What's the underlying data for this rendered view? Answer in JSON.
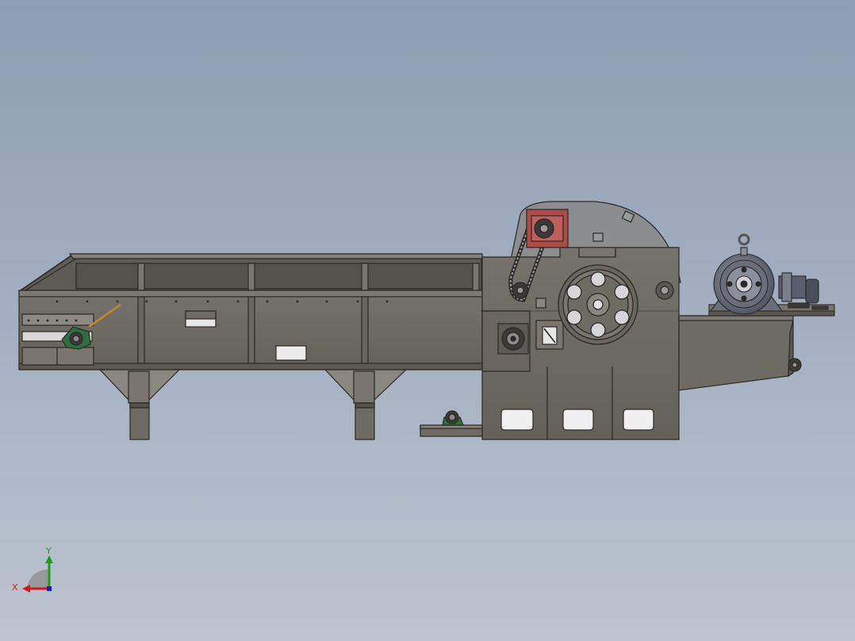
{
  "viewport": {
    "background_top": "#8e9db2",
    "background_bottom": "#bcc4cf"
  },
  "model": {
    "body_color": "#6e6a64",
    "edge_color": "#2a2826",
    "guard_color": "#8a8a8a",
    "gearbox_color": "#b04a48",
    "bearing_color": "#2e6e3c",
    "motor_color": "#5a5f6e"
  },
  "triad": {
    "x_label": "X",
    "y_label": "Y",
    "x_color": "#d01818",
    "y_color": "#18a018",
    "z_color": "#1818c8"
  }
}
